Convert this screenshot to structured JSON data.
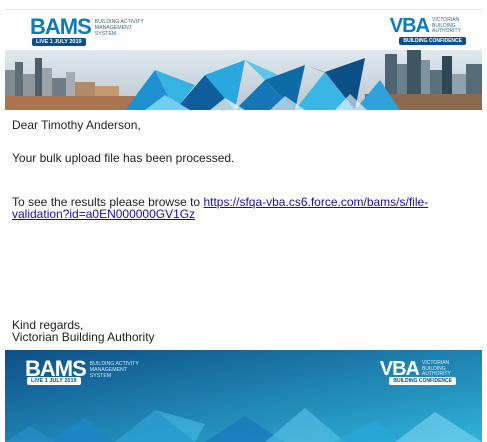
{
  "header": {
    "bams_logo_text": "BAMS",
    "bams_subtitle": "BUILDING ACTIVITY MANAGEMENT SYSTEM",
    "live_badge": "LIVE 1 JULY 2019",
    "vba_logo_text": "VBA",
    "vba_subtitle": "VICTORIAN BUILDING AUTHORITY",
    "vba_badge": "BUILDING CONFIDENCE"
  },
  "email": {
    "salutation": "Dear Timothy Anderson,",
    "processed_message": "Your bulk upload file has been processed.",
    "results_prefix": "To see the results please browse to ",
    "results_link": "https://sfqa-vba.cs6.force.com/bams/s/file-validation?id=a0EN000000GV1Gz",
    "closing": "Kind regards,",
    "signature": "Victorian Building Authority"
  },
  "footer": {
    "bams_logo_text": "BAMS",
    "bams_subtitle": "BUILDING ACTIVITY MANAGEMENT SYSTEM",
    "live_badge": "LIVE 1 JULY 2019",
    "vba_logo_text": "VBA",
    "vba_subtitle": "VICTORIAN BUILDING AUTHORITY",
    "vba_badge": "BUILDING CONFIDENCE"
  },
  "colors": {
    "brand_blue": "#0b7bbd",
    "navy": "#0a4f88",
    "link": "#1a0dab",
    "footer_gradient_start": "#0d4f86",
    "footer_gradient_end": "#2fb3d9"
  }
}
